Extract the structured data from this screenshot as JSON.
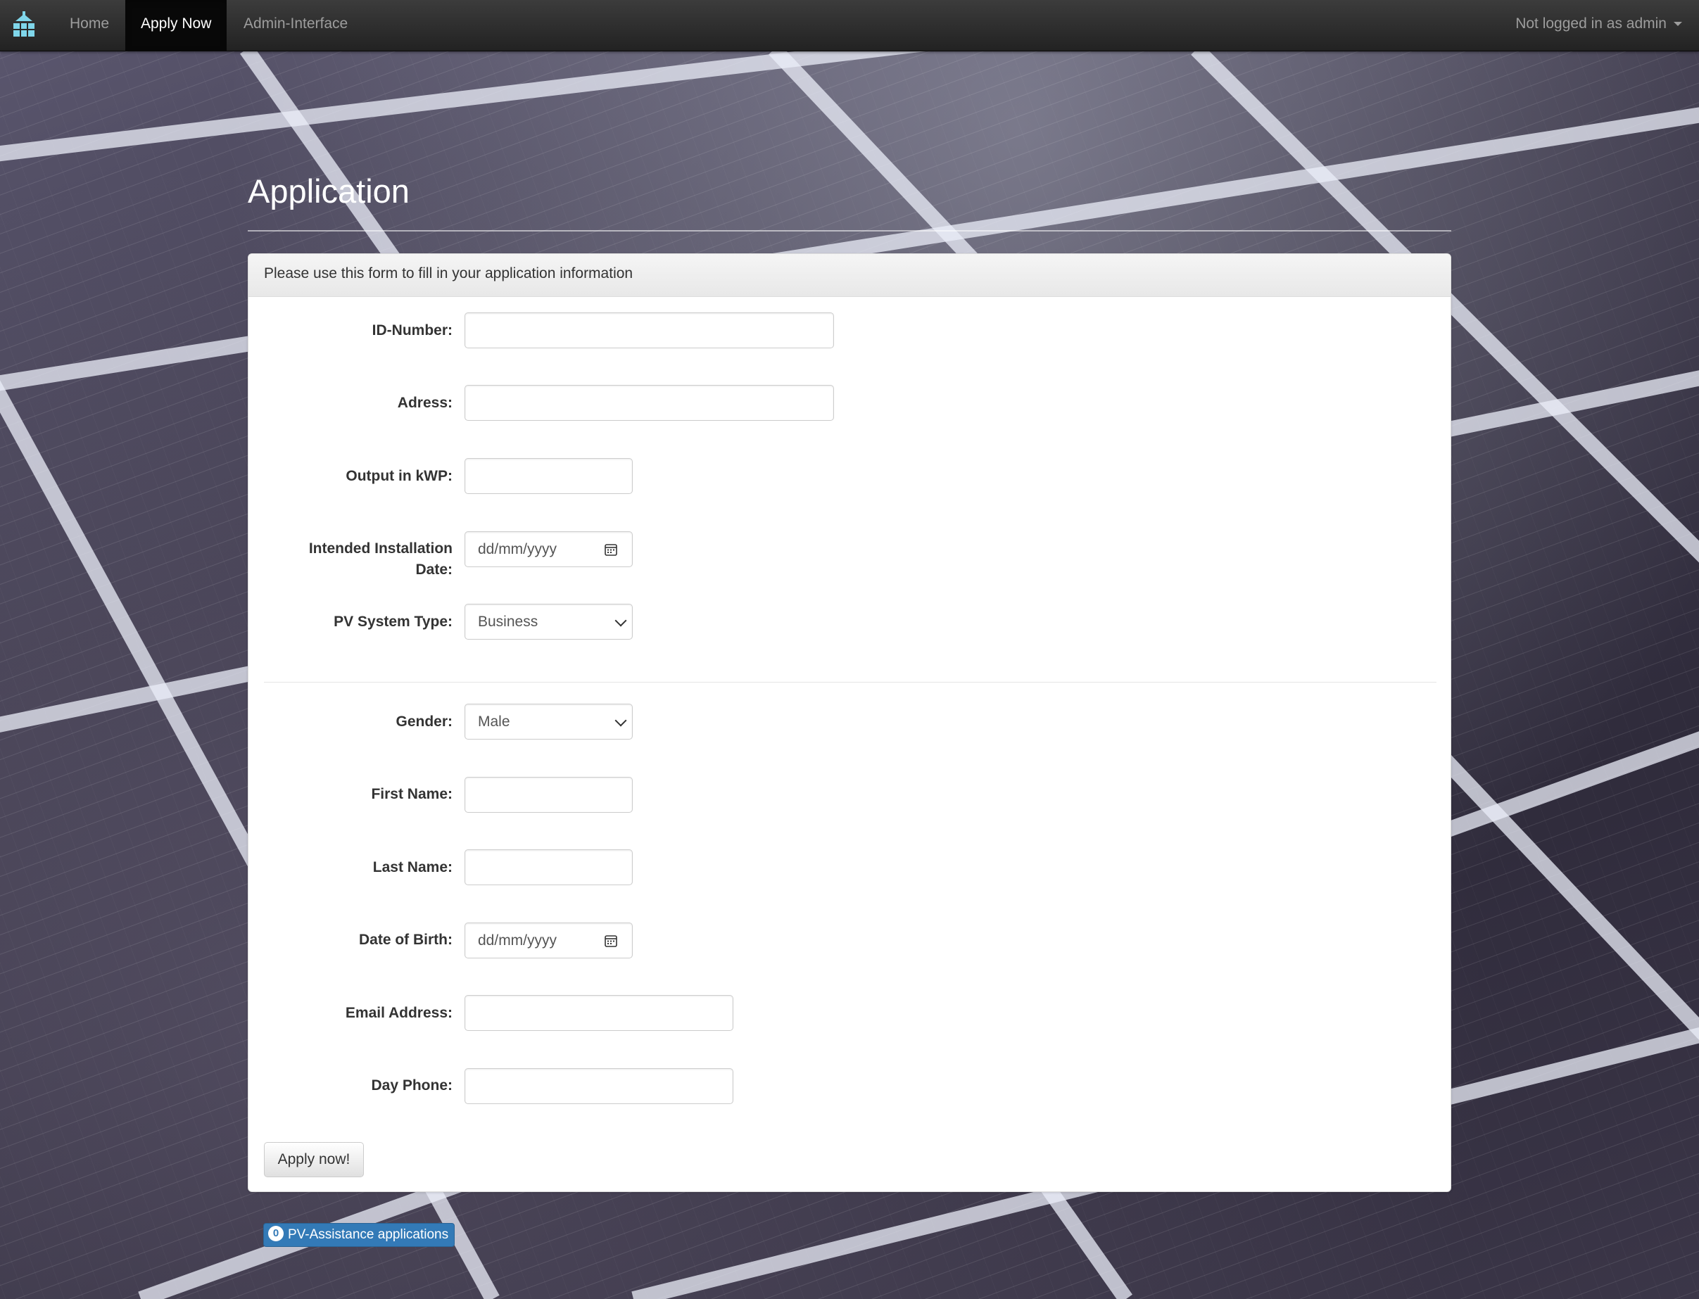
{
  "navbar": {
    "brand_icon": "solar-panel-logo-icon",
    "items": [
      {
        "label": "Home",
        "active": false
      },
      {
        "label": "Apply Now",
        "active": true
      },
      {
        "label": "Admin-Interface",
        "active": false
      }
    ],
    "user_menu": "Not logged in as admin"
  },
  "page": {
    "title": "Application"
  },
  "form": {
    "panel_heading": "Please use this form to fill in your application information",
    "fields": {
      "id_number": {
        "label": "ID-Number:",
        "value": ""
      },
      "address": {
        "label": "Adress:",
        "value": ""
      },
      "output": {
        "label": "Output in kWP:",
        "value": ""
      },
      "install_date": {
        "label_line1": "Intended Installation",
        "label_line2": "Date:",
        "placeholder": "dd/mm/yyyy"
      },
      "pv_type": {
        "label": "PV System Type:",
        "value": "Business"
      },
      "gender": {
        "label": "Gender:",
        "value": "Male"
      },
      "first_name": {
        "label": "First Name:",
        "value": ""
      },
      "last_name": {
        "label": "Last Name:",
        "value": ""
      },
      "dob": {
        "label": "Date of Birth:",
        "placeholder": "dd/mm/yyyy"
      },
      "email": {
        "label": "Email Address:",
        "value": ""
      },
      "phone": {
        "label": "Day Phone:",
        "value": ""
      }
    },
    "submit_label": "Apply now!"
  },
  "footer_link": {
    "count": "0",
    "label": "PV-Assistance applications"
  },
  "colors": {
    "navbar": "#222222",
    "primary": "#337ab7"
  }
}
